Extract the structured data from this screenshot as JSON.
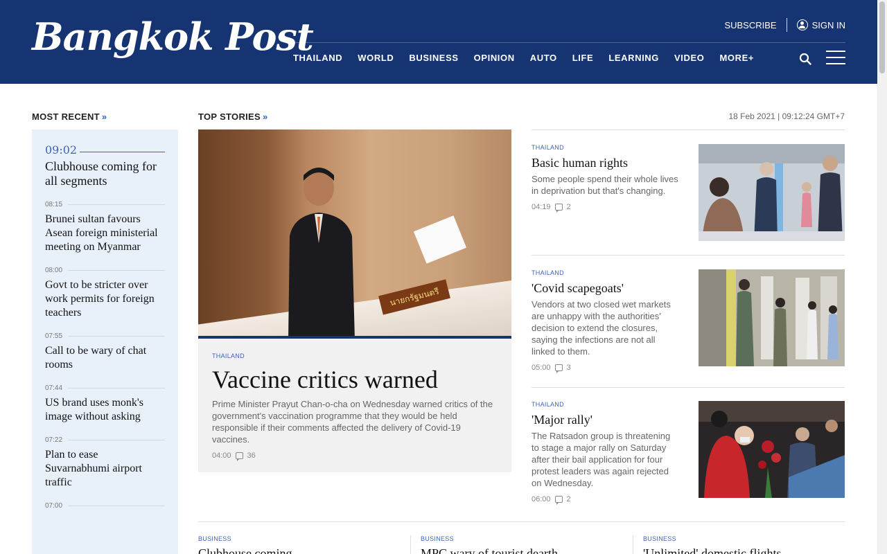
{
  "header": {
    "logo": "Bangkok Post",
    "subscribe": "SUBSCRIBE",
    "signin": "SIGN IN",
    "nav": [
      "THAILAND",
      "WORLD",
      "BUSINESS",
      "OPINION",
      "AUTO",
      "LIFE",
      "LEARNING",
      "VIDEO",
      "MORE+"
    ]
  },
  "colors": {
    "brand": "#163372",
    "accent": "#3d63b8",
    "recent_bg": "#e8f0fa"
  },
  "sections": {
    "most_recent": "MOST RECENT",
    "top_stories": "TOP STORIES",
    "chevron": "»",
    "date": "18 Feb 2021 | 09:12:24 GMT+7"
  },
  "recent": [
    {
      "time": "09:02",
      "title": "Clubhouse coming for all segments"
    },
    {
      "time": "08:15",
      "title": "Brunei sultan favours Asean foreign ministerial meeting on Myanmar"
    },
    {
      "time": "08:00",
      "title": "Govt to be stricter over work permits for foreign teachers"
    },
    {
      "time": "07:55",
      "title": "Call to be wary of chat rooms"
    },
    {
      "time": "07:44",
      "title": "US brand uses monk's image without asking"
    },
    {
      "time": "07:22",
      "title": "Plan to ease Suvarnabhumi airport traffic"
    },
    {
      "time": "07:00",
      "title": ""
    }
  ],
  "feature": {
    "nameplate": "นายกรัฐมนตรี",
    "category": "THAILAND",
    "headline": "Vaccine critics warned",
    "dek": "Prime Minister Prayut Chan-o-cha on Wednesday warned critics of the government's vaccination programme that they would be held responsible if their comments affected the delivery of Covid-19 vaccines.",
    "time": "04:00",
    "comments": "36"
  },
  "stories": [
    {
      "category": "THAILAND",
      "headline": "Basic human rights",
      "dek": "Some people spend their whole lives in deprivation but that's changing.",
      "time": "04:19",
      "comments": "2"
    },
    {
      "category": "THAILAND",
      "headline": "'Covid scapegoats'",
      "dek": "Vendors at two closed wet markets are unhappy with the authorities' decision to extend the closures, saying the infections are not all linked to them.",
      "time": "05:00",
      "comments": "3"
    },
    {
      "category": "THAILAND",
      "headline": "'Major rally'",
      "dek": "The Ratsadon group is threatening to stage a major rally on Saturday after their bail application for four protest leaders was again rejected on Wednesday.",
      "time": "06:00",
      "comments": "2"
    }
  ],
  "bottom": [
    {
      "category": "BUSINESS",
      "headline": "Clubhouse coming"
    },
    {
      "category": "BUSINESS",
      "headline": "MPC wary of tourist dearth"
    },
    {
      "category": "BUSINESS",
      "headline": "'Unlimited' domestic flights"
    }
  ]
}
